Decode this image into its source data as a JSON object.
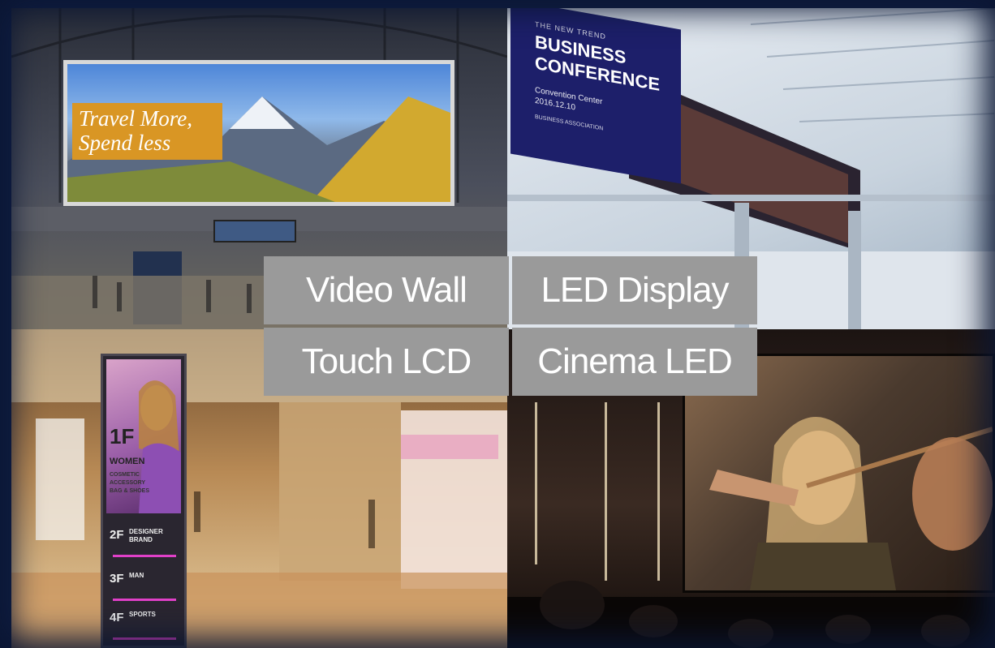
{
  "quadrants": {
    "video_wall": {
      "billboard_text": "Travel More, Spend less"
    },
    "led_display": {
      "banner_eyebrow": "THE NEW TREND",
      "banner_title": "BUSINESS CONFERENCE",
      "banner_venue": "Convention Center",
      "banner_date": "2016.12.10",
      "banner_org": "BUSINESS ASSOCIATION"
    },
    "touch_lcd": {
      "kiosk_floor": "1F",
      "kiosk_category": "WOMEN",
      "kiosk_desc": "COSMETIC ACCESSORY BAG & SHOES",
      "floors": [
        {
          "num": "2F",
          "label": "DESIGNER BRAND"
        },
        {
          "num": "3F",
          "label": "MAN"
        },
        {
          "num": "4F",
          "label": "SPORTS"
        }
      ]
    },
    "cinema_led": {}
  },
  "labels": {
    "video_wall": "Video Wall",
    "led_display": "LED Display",
    "touch_lcd": "Touch LCD",
    "cinema_led": "Cinema LED"
  },
  "colors": {
    "label_bg": "#9a9a9a",
    "label_text": "#ffffff",
    "frame": "#101f45",
    "banner": "#1d1f6a",
    "billboard_tag": "#d99624",
    "kiosk_accent": "#e040c8"
  }
}
